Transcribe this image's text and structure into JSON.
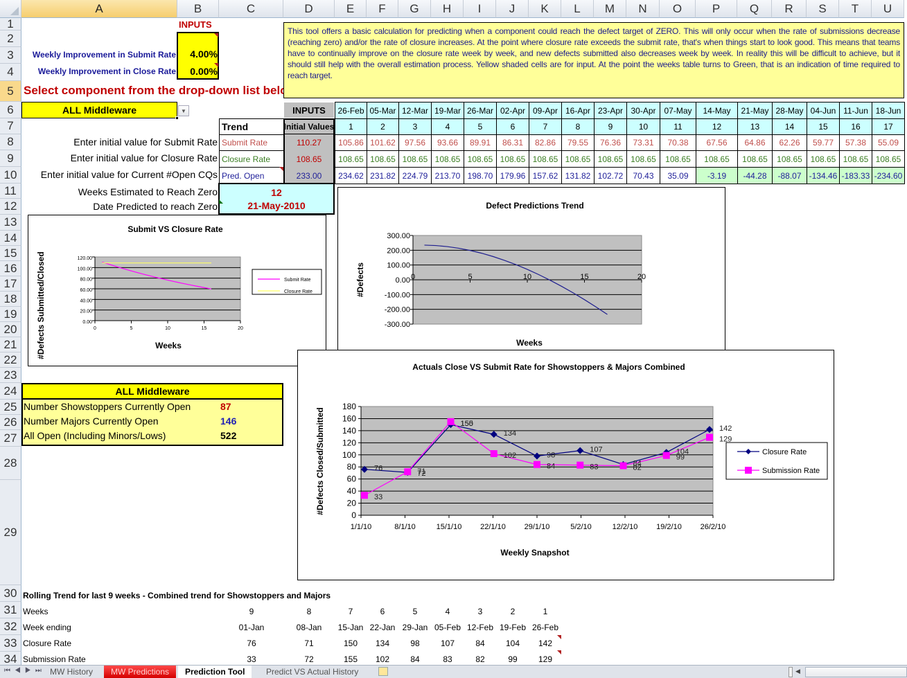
{
  "columns": [
    "A",
    "B",
    "C",
    "D",
    "E",
    "F",
    "G",
    "H",
    "I",
    "J",
    "K",
    "L",
    "M",
    "N",
    "O",
    "P",
    "Q",
    "R",
    "S",
    "T",
    "U"
  ],
  "rows": [
    "1",
    "2",
    "3",
    "4",
    "5",
    "6",
    "7",
    "8",
    "9",
    "10",
    "11",
    "12",
    "13",
    "14",
    "15",
    "16",
    "17",
    "18",
    "19",
    "20",
    "21",
    "22",
    "23",
    "24",
    "25",
    "26",
    "27",
    "28",
    "29",
    "30",
    "31",
    "32",
    "33",
    "34"
  ],
  "inputs": {
    "title": "INPUTS",
    "submit_label": "Weekly Improvement in Submit Rate",
    "submit_value": "4.00%",
    "close_label": "Weekly Improvement in Close Rate",
    "close_value": "0.00%"
  },
  "select_prompt": "Select component from the drop-down list below",
  "component_dropdown": {
    "value": "ALL Middleware"
  },
  "description": "This tool offers a basic calculation for predicting when a component could reach the defect target of ZERO. This will only occur when the rate of submissions decrease (reaching zero) and/or the rate of closure increases. At the point where closure rate exceeds the submit rate, that's when things start to look good. This means that teams have to continually improve on the closure rate week by week, and new defects submitted also decreases week by week. In reality this will be difficult to achieve, but it should still help with the overall estimation process. Yellow shaded cells are for input. At the point the weeks table turns to Green, that is an indication of time required to reach target.",
  "prediction_table": {
    "inputs_header": "INPUTS",
    "trend_header": "Trend",
    "initial_values_header": "Initial Values",
    "dates": [
      "26-Feb",
      "05-Mar",
      "12-Mar",
      "19-Mar",
      "26-Mar",
      "02-Apr",
      "09-Apr",
      "16-Apr",
      "23-Apr",
      "30-Apr",
      "07-May",
      "14-May",
      "21-May",
      "28-May",
      "04-Jun",
      "11-Jun",
      "18-Jun"
    ],
    "weeks": [
      "1",
      "2",
      "3",
      "4",
      "5",
      "6",
      "7",
      "8",
      "9",
      "10",
      "11",
      "12",
      "13",
      "14",
      "15",
      "16",
      "17"
    ],
    "rows": [
      {
        "prompt": "Enter initial value for Submit Rate",
        "trend": "Submit Rate",
        "initial": "110.27",
        "values": [
          "105.86",
          "101.62",
          "97.56",
          "93.66",
          "89.91",
          "86.31",
          "82.86",
          "79.55",
          "76.36",
          "73.31",
          "70.38",
          "67.56",
          "64.86",
          "62.26",
          "59.77",
          "57.38",
          "55.09"
        ]
      },
      {
        "prompt": "Enter initial value for Closure Rate",
        "trend": "Closure Rate",
        "initial": "108.65",
        "values": [
          "108.65",
          "108.65",
          "108.65",
          "108.65",
          "108.65",
          "108.65",
          "108.65",
          "108.65",
          "108.65",
          "108.65",
          "108.65",
          "108.65",
          "108.65",
          "108.65",
          "108.65",
          "108.65",
          "108.65"
        ]
      },
      {
        "prompt": "Enter initial value for Current #Open CQs",
        "trend": "Pred. Open",
        "initial": "233.00",
        "values": [
          "234.62",
          "231.82",
          "224.79",
          "213.70",
          "198.70",
          "179.96",
          "157.62",
          "131.82",
          "102.72",
          "70.43",
          "35.09",
          "-3.19",
          "-44.28",
          "-88.07",
          "-134.46",
          "-183.33",
          "-234.60"
        ]
      }
    ],
    "colors": {
      "submit": "#c0504d",
      "closure": "#3a7d22",
      "open": "#1f1f99",
      "header_bg": "#ccffff",
      "inputs_bg": "#c0c0c0",
      "green_bg": "#ccffcc"
    }
  },
  "estimate": {
    "weeks_label": "Weeks Estimated to Reach Zero",
    "weeks_value": "12",
    "date_label": "Date Predicted to reach Zero",
    "date_value": "21-May-2010"
  },
  "summary": {
    "title": "ALL Middleware",
    "rows": [
      {
        "label": "Number Showstoppers Currently Open",
        "value": "87",
        "color": "#c00000"
      },
      {
        "label": "Number Majors Currently Open",
        "value": "146",
        "color": "#1f1fb4"
      },
      {
        "label": "All Open (Including Minors/Lows)",
        "value": "522",
        "color": "#000000"
      }
    ]
  },
  "rolling": {
    "title": "Rolling Trend for last 9 weeks - Combined trend for Showstoppers and Majors",
    "labels": [
      "Weeks",
      "Week ending",
      "Closure Rate",
      "Submission Rate"
    ],
    "weeks": [
      "9",
      "8",
      "7",
      "6",
      "5",
      "4",
      "3",
      "2",
      "1"
    ],
    "week_ending": [
      "01-Jan",
      "08-Jan",
      "15-Jan",
      "22-Jan",
      "29-Jan",
      "05-Feb",
      "12-Feb",
      "19-Feb",
      "26-Feb"
    ],
    "closure": [
      "76",
      "71",
      "150",
      "134",
      "98",
      "107",
      "84",
      "104",
      "142"
    ],
    "submission": [
      "33",
      "72",
      "155",
      "102",
      "84",
      "83",
      "82",
      "99",
      "129"
    ]
  },
  "chart_data": [
    {
      "type": "line",
      "title": "Submit VS Closure Rate",
      "xlabel": "Weeks",
      "ylabel": "#Defects Submitted/Closed",
      "xlim": [
        0,
        20
      ],
      "ylim": [
        0,
        120
      ],
      "xticks": [
        "0",
        "5",
        "10",
        "15",
        "20"
      ],
      "yticks": [
        "0.00",
        "20.00",
        "40.00",
        "60.00",
        "80.00",
        "100.00",
        "120.00"
      ],
      "grid": true,
      "legend": "right",
      "x": [
        1,
        2,
        3,
        4,
        5,
        6,
        7,
        8,
        9,
        10,
        11,
        12,
        13,
        14,
        15,
        16
      ],
      "series": [
        {
          "name": "Submit Rate",
          "color": "#ff00ff",
          "values": [
            110.27,
            105.86,
            101.62,
            97.56,
            93.66,
            89.91,
            86.31,
            82.86,
            79.55,
            76.36,
            73.31,
            70.38,
            67.56,
            64.86,
            62.26,
            59.77
          ]
        },
        {
          "name": "Closure Rate",
          "color": "#ffff66",
          "values": [
            108.65,
            108.65,
            108.65,
            108.65,
            108.65,
            108.65,
            108.65,
            108.65,
            108.65,
            108.65,
            108.65,
            108.65,
            108.65,
            108.65,
            108.65,
            108.65
          ]
        }
      ]
    },
    {
      "type": "line",
      "title": "Defect Predictions Trend",
      "xlabel": "Weeks",
      "ylabel": "#Defects",
      "xlim": [
        0,
        20
      ],
      "ylim": [
        -300,
        300
      ],
      "xticks": [
        "0",
        "5",
        "10",
        "15",
        "20"
      ],
      "yticks": [
        "-300.00",
        "-200.00",
        "-100.00",
        "0.00",
        "100.00",
        "200.00",
        "300.00"
      ],
      "grid": true,
      "legend": "none",
      "x": [
        1,
        2,
        3,
        4,
        5,
        6,
        7,
        8,
        9,
        10,
        11,
        12,
        13,
        14,
        15,
        16,
        17
      ],
      "series": [
        {
          "name": "Pred. Open",
          "color": "#1f1f8f",
          "values": [
            234.62,
            231.82,
            224.79,
            213.7,
            198.7,
            179.96,
            157.62,
            131.82,
            102.72,
            70.43,
            35.09,
            -3.19,
            -44.28,
            -88.07,
            -134.46,
            -183.33,
            -234.6
          ]
        }
      ]
    },
    {
      "type": "line",
      "title": "Actuals Close VS Submit Rate for Showstoppers & Majors Combined",
      "xlabel": "Weekly Snapshot",
      "ylabel": "#Defects Closed/Submitted",
      "categories": [
        "1/1/10",
        "8/1/10",
        "15/1/10",
        "22/1/10",
        "29/1/10",
        "5/2/10",
        "12/2/10",
        "19/2/10",
        "26/2/10"
      ],
      "ylim": [
        0,
        180
      ],
      "yticks": [
        "0",
        "20",
        "40",
        "60",
        "80",
        "100",
        "120",
        "140",
        "160",
        "180"
      ],
      "grid": true,
      "legend": "right",
      "series": [
        {
          "name": "Closure Rate",
          "color": "#000080",
          "marker": "diamond",
          "values": [
            76,
            71,
            150,
            134,
            98,
            107,
            84,
            104,
            142
          ]
        },
        {
          "name": "Submission Rate",
          "color": "#ff00ff",
          "marker": "square",
          "values": [
            33,
            72,
            155,
            102,
            84,
            83,
            82,
            99,
            129
          ]
        }
      ]
    }
  ],
  "sheet_tabs": [
    {
      "label": "MW History",
      "state": "normal"
    },
    {
      "label": "MW Predictions",
      "state": "red"
    },
    {
      "label": "Prediction Tool",
      "state": "active"
    },
    {
      "label": "Predict VS Actual History",
      "state": "normal"
    }
  ]
}
